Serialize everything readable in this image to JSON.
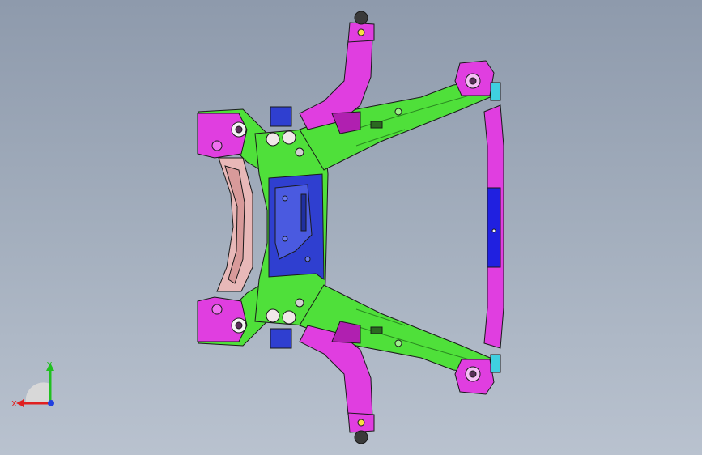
{
  "viewport": {
    "background_top": "#8e9aac",
    "background_bottom": "#b9c2cf"
  },
  "model": {
    "description_icon": "subframe-assembly-icon",
    "colors": {
      "frame_green": "#4fe03a",
      "arm_magenta": "#e03ee0",
      "plate_blue": "#2f3fd0",
      "bracket_pink": "#e8b8b8",
      "bushing_dark": "#5a2f5a",
      "crossmember_blue": "#2020e0",
      "cyan_tab": "#3fd0e0",
      "edge_black": "#1a1a1a"
    }
  },
  "triad": {
    "x_label": "X",
    "y_label": "Y",
    "x_color": "#e02020",
    "y_color": "#20c020",
    "z_color": "#2040e0"
  }
}
